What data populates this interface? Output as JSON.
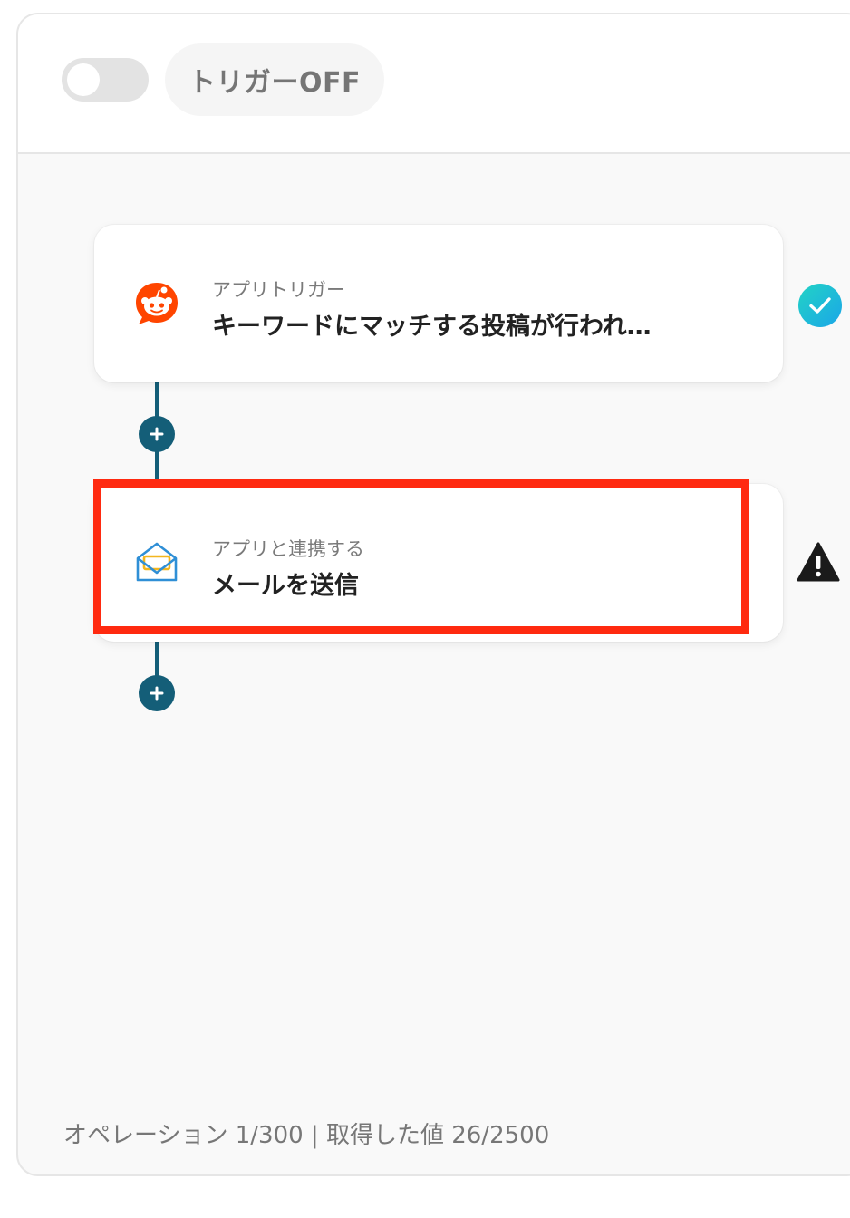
{
  "header": {
    "toggle_state": "off",
    "trigger_status_label": "トリガーOFF"
  },
  "flow": {
    "steps": [
      {
        "subtitle": "アプリトリガー",
        "title": "キーワードにマッチする投稿が行われ…",
        "app_icon": "reddit-icon",
        "status": "check-circle-icon",
        "status_color": "#1bc8d8"
      },
      {
        "subtitle": "アプリと連携する",
        "title": "メールを送信",
        "app_icon": "email-envelope-icon",
        "status": "warning-triangle-icon",
        "status_color": "#1a1a1a",
        "highlighted": true,
        "highlight_color": "#ff2a10"
      }
    ],
    "add_step_icon": "plus-icon",
    "connector_color": "#145e78"
  },
  "footer": {
    "usage_text": "オペレーション 1/300 | 取得した値 26/2500"
  }
}
